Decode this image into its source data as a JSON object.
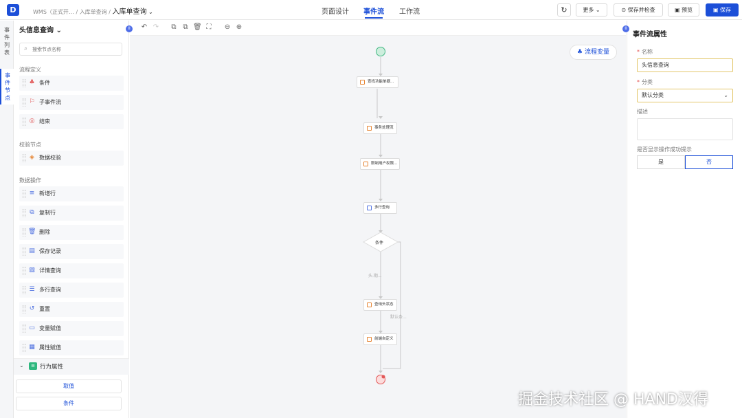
{
  "header": {
    "logo_text": "D",
    "breadcrumb": {
      "app": "WMS（正式开…",
      "sep1": "/",
      "module": "入库单查询",
      "sep2": "/",
      "current": "入库单查询",
      "chevron": "⌄"
    },
    "tabs": [
      {
        "label": "页面设计",
        "active": false
      },
      {
        "label": "事件流",
        "active": true
      },
      {
        "label": "工作流",
        "active": false
      }
    ],
    "refresh_icon": "↻",
    "more_label": "更多 ⌄",
    "save_check_label": "⊙ 保存并检查",
    "preview_label": "▣ 预览",
    "save_label": "▣ 保存",
    "accent_color": "#1c4fd8"
  },
  "vtabs": [
    {
      "label": "事件列表",
      "active": false
    },
    {
      "label": "事件节点",
      "active": true
    }
  ],
  "left_panel": {
    "title": "头信息查询 ⌄",
    "toggle": "II",
    "search_placeholder": "搜索节点名称",
    "sections": [
      {
        "title": "流程定义",
        "items": [
          {
            "label": "条件",
            "icon": "condition-icon",
            "glyph": "♣",
            "color": "#e25757"
          },
          {
            "label": "子事件流",
            "icon": "subflow-icon",
            "glyph": "⚐",
            "color": "#e25757"
          },
          {
            "label": "结束",
            "icon": "end-icon",
            "glyph": "◎",
            "color": "#e25757"
          }
        ]
      },
      {
        "title": "校验节点",
        "items": [
          {
            "label": "数据校验",
            "icon": "data-validate-icon",
            "glyph": "◈",
            "color": "#e5822f"
          }
        ]
      },
      {
        "title": "数据操作",
        "items": [
          {
            "label": "新增行",
            "icon": "add-row-icon",
            "glyph": "≡",
            "color": "#4c6fe0"
          },
          {
            "label": "复制行",
            "icon": "copy-row-icon",
            "glyph": "⧉",
            "color": "#4c6fe0"
          },
          {
            "label": "删除",
            "icon": "delete-icon",
            "glyph": "🗑",
            "color": "#4c6fe0"
          },
          {
            "label": "保存记录",
            "icon": "save-record-icon",
            "glyph": "▤",
            "color": "#4c6fe0"
          },
          {
            "label": "详情查询",
            "icon": "detail-query-icon",
            "glyph": "▧",
            "color": "#4c6fe0"
          },
          {
            "label": "多行查询",
            "icon": "multi-query-icon",
            "glyph": "☰",
            "color": "#4c6fe0"
          },
          {
            "label": "重置",
            "icon": "reset-icon",
            "glyph": "↺",
            "color": "#4c6fe0"
          },
          {
            "label": "变量赋值",
            "icon": "var-assign-icon",
            "glyph": "▭",
            "color": "#4c6fe0"
          },
          {
            "label": "属性赋值",
            "icon": "prop-assign-icon",
            "glyph": "▦",
            "color": "#4c6fe0"
          }
        ]
      }
    ],
    "behavior": {
      "chevron": "⌄",
      "label": "行为属性",
      "icon": "≡"
    },
    "actions": [
      {
        "label": "取值"
      },
      {
        "label": "条件"
      }
    ]
  },
  "toolbar": {
    "undo": "↶",
    "redo": "↷",
    "copy": "⧉",
    "paste": "⧉",
    "delete": "🗑",
    "fit": "⛶",
    "zoom_out": "⊖",
    "zoom_in": "⊕"
  },
  "canvas": {
    "flow_vars_label": "♣ 流程变量",
    "nodes": [
      {
        "label": "查找功能单据…",
        "icon": "orange"
      },
      {
        "label": "事务处理流",
        "icon": "orange"
      },
      {
        "label": "限制用户权限…",
        "icon": "orange"
      },
      {
        "label": "多行查询",
        "icon": "blue"
      },
      {
        "label": "查询头状态",
        "icon": "orange"
      },
      {
        "label": "前端自定义",
        "icon": "orange"
      }
    ],
    "condition_label": "条件",
    "edge_labels": [
      "头.期...",
      "默认条..."
    ]
  },
  "right_panel": {
    "title": "事件流属性",
    "toggle": "II",
    "name_label": "名称",
    "name_value": "头信息查询",
    "category_label": "分类",
    "category_value": "默认分类",
    "category_chevron": "⌄",
    "description_label": "描述",
    "show_success_label": "是否显示操作成功提示",
    "yes_label": "是",
    "no_label": "否",
    "selected": "否",
    "required_mark": "*"
  },
  "watermark": "掘金技术社区 @ HAND汉得"
}
